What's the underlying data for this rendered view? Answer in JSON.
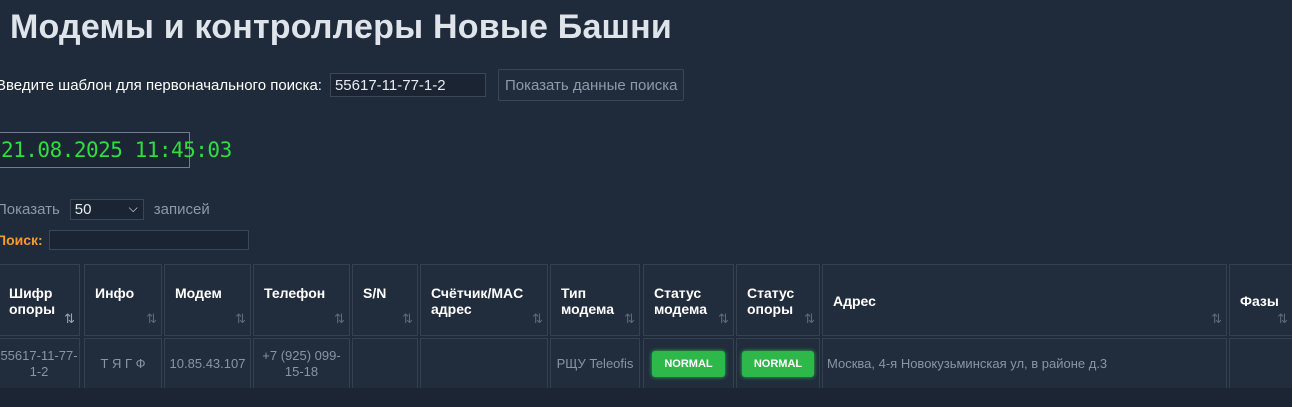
{
  "page": {
    "title": "Модемы и контроллеры Новые Башни"
  },
  "search": {
    "label": "Введите шаблон для первоначального поиска:",
    "value": "55617-11-77-1-2",
    "button_label": "Показать данные поиска"
  },
  "clock": {
    "text": "21.08.2025 11:45:03",
    "color": "#2ede3e"
  },
  "length": {
    "prefix": "Показать",
    "value": "50",
    "suffix": "записей"
  },
  "filter": {
    "label": "Поиск:",
    "value": ""
  },
  "table": {
    "headers": [
      {
        "label": "Шифр опоры",
        "sort_active": true
      },
      {
        "label": "Инфо"
      },
      {
        "label": "Модем"
      },
      {
        "label": "Телефон"
      },
      {
        "label": "S/N"
      },
      {
        "label": "Счётчик/MAC адрес"
      },
      {
        "label": "Тип модема"
      },
      {
        "label": "Статус модема"
      },
      {
        "label": "Статус опоры"
      },
      {
        "label": "Адрес"
      },
      {
        "label": "Фазы"
      }
    ],
    "rows": [
      {
        "code": "55617-11-77-1-2",
        "info": "Т Я Г Ф",
        "modem": "10.85.43.107",
        "phone": "+7 (925) 099-15-18",
        "sn": "",
        "meter": "",
        "type": "РЩУ Teleofis",
        "modem_status": "NORMAL",
        "pole_status": "NORMAL",
        "address": "Москва, 4-я Новокузьминская ул, в районе д.3",
        "phases": ""
      }
    ]
  },
  "colors": {
    "background": "#1f2a3a",
    "accent_orange": "#f39c2b",
    "status_green": "#2fb84a"
  }
}
